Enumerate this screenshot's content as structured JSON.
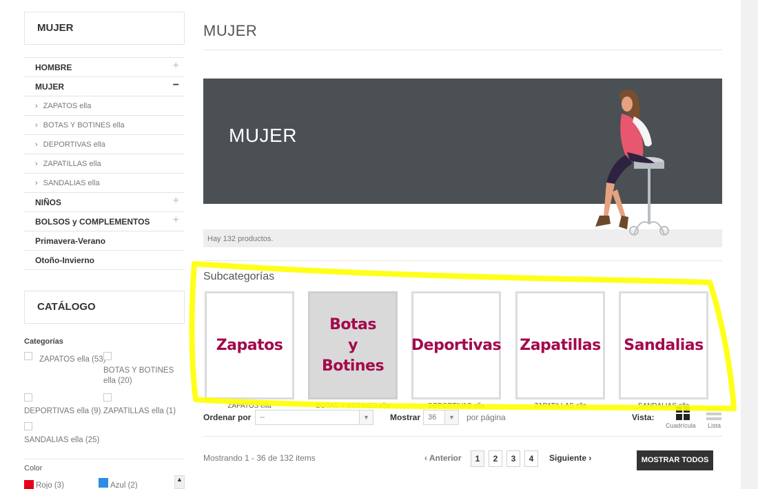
{
  "sidebar": {
    "block_title": "MUJER",
    "menu": [
      {
        "label": "HOMBRE",
        "toggle": "+"
      },
      {
        "label": "MUJER",
        "toggle": "−"
      },
      {
        "label": "ZAPATOS ella"
      },
      {
        "label": "BOTAS Y BOTINES ella"
      },
      {
        "label": "DEPORTIVAS ella"
      },
      {
        "label": "ZAPATILLAS ella"
      },
      {
        "label": "SANDALIAS ella"
      },
      {
        "label": "NIÑOS",
        "toggle": "+"
      },
      {
        "label": "BOLSOS y COMPLEMENTOS",
        "toggle": "+"
      },
      {
        "label": "Primavera-Verano"
      },
      {
        "label": "Otoño-Invierno"
      }
    ],
    "catalog_title": "CATÁLOGO",
    "categories_heading": "Categorías",
    "categories": [
      {
        "label": "ZAPATOS ella (53)"
      },
      {
        "label": "BOTAS Y BOTINES ella (20)"
      },
      {
        "label": "DEPORTIVAS ella (9)"
      },
      {
        "label": "ZAPATILLAS ella (1)"
      },
      {
        "label": "SANDALIAS ella (25)"
      }
    ],
    "color_heading": "Color",
    "colors": [
      {
        "label": "Rojo (3)",
        "swatch": "#e4001b"
      },
      {
        "label": "Azul (2)",
        "swatch": "#2e8be6"
      }
    ]
  },
  "main": {
    "title": "MUJER",
    "banner_title": "MUJER",
    "product_count": "Hay 132 productos.",
    "subcategories_title": "Subcategorías",
    "subcategories": [
      {
        "tile_lines": [
          "Zapatos"
        ],
        "caption": "ZAPATOS ella"
      },
      {
        "tile_lines": [
          "Botas",
          "y",
          "Botines"
        ],
        "caption": "BOTAS Y BOTINES ella"
      },
      {
        "tile_lines": [
          "Deportivas"
        ],
        "caption": "DEPORTIVAS ella"
      },
      {
        "tile_lines": [
          "Zapatillas"
        ],
        "caption": "ZAPATILLAS ella"
      },
      {
        "tile_lines": [
          "Sandalias"
        ],
        "caption": "SANDALIAS ella"
      }
    ],
    "toolbar": {
      "order_label": "Ordenar por",
      "order_value": "--",
      "show_label": "Mostrar",
      "show_value": "36",
      "per_page": "por página",
      "view_label": "Vista:",
      "view_grid": "Cuadrícula",
      "view_list": "Lista"
    },
    "pagination": {
      "showing": "Mostrando 1 - 36 de 132 items",
      "prev": "Anterior",
      "pages": [
        "1",
        "2",
        "3",
        "4"
      ],
      "next": "Siguiente",
      "show_all": "MOSTRAR TODOS"
    }
  },
  "highlight_color": "#ffff00"
}
